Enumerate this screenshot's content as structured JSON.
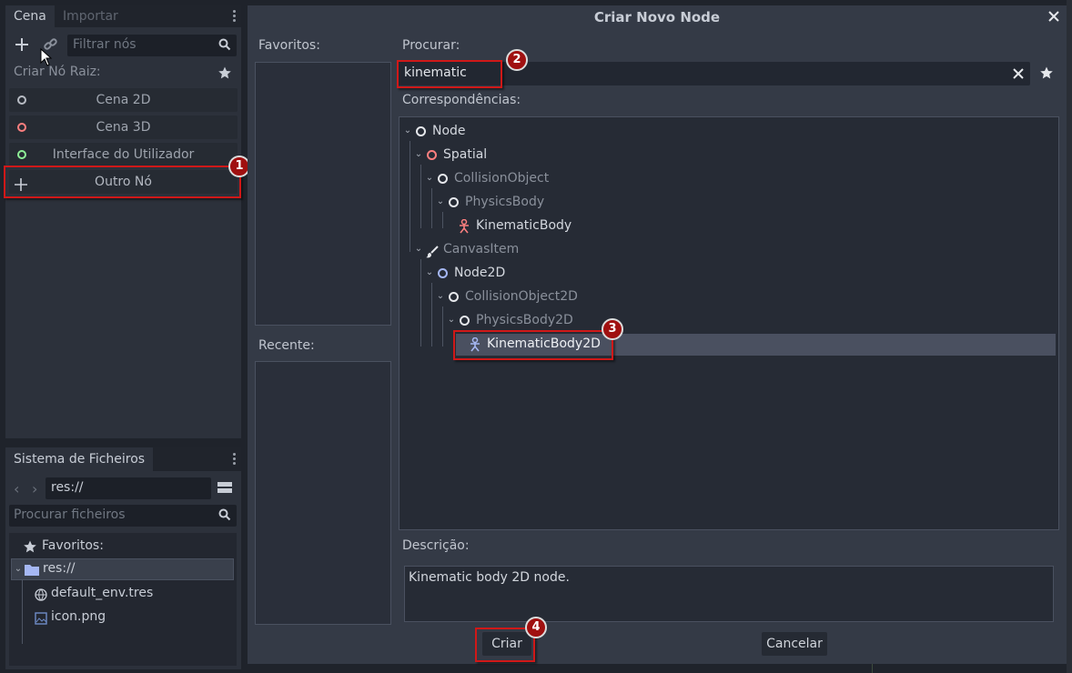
{
  "scene_dock": {
    "tabs": [
      "Cena",
      "Importar"
    ],
    "filter_placeholder": "Filtrar nós",
    "create_root_label": "Criar Nó Raiz:",
    "root_buttons": [
      {
        "label": "Cena 2D",
        "color": "#b8bcc4"
      },
      {
        "label": "Cena 3D",
        "color": "#fc7f7f"
      },
      {
        "label": "Interface do Utilizador",
        "color": "#8eef97"
      },
      {
        "label": "Outro Nó",
        "color": "#c8cdd6"
      }
    ]
  },
  "fs_dock": {
    "title": "Sistema de Ficheiros",
    "path": "res://",
    "search_placeholder": "Procurar ficheiros",
    "favorites_label": "Favoritos:",
    "items": [
      "res://",
      "default_env.tres",
      "icon.png"
    ]
  },
  "dialog": {
    "title": "Criar Novo Node",
    "favorites_label": "Favoritos:",
    "recent_label": "Recente:",
    "search_label": "Procurar:",
    "search_value": "kinematic",
    "matches_label": "Correspondências:",
    "tree": [
      {
        "label": "Node",
        "icon": "ring-white",
        "style": "bright"
      },
      {
        "label": "Spatial",
        "icon": "ring-red",
        "style": "bright"
      },
      {
        "label": "CollisionObject",
        "icon": "ring-white",
        "style": "dim"
      },
      {
        "label": "PhysicsBody",
        "icon": "ring-white",
        "style": "dim"
      },
      {
        "label": "KinematicBody",
        "icon": "kinematic-red-icon",
        "style": "bright"
      },
      {
        "label": "CanvasItem",
        "icon": "brush-icon",
        "style": "dim"
      },
      {
        "label": "Node2D",
        "icon": "ring-blue",
        "style": "bright"
      },
      {
        "label": "CollisionObject2D",
        "icon": "ring-white",
        "style": "dim"
      },
      {
        "label": "PhysicsBody2D",
        "icon": "ring-white",
        "style": "dim"
      },
      {
        "label": "KinematicBody2D",
        "icon": "kinematic-blue-icon",
        "style": "bright"
      }
    ],
    "description_label": "Descrição:",
    "description_text": "Kinematic body 2D node.",
    "create_button": "Criar",
    "cancel_button": "Cancelar"
  },
  "annotations": [
    "1",
    "2",
    "3",
    "4"
  ],
  "colors": {
    "highlight": "#d01818",
    "badge": "#a01010",
    "dialog_bg": "#343a46",
    "selected_row": "#4a5060"
  }
}
